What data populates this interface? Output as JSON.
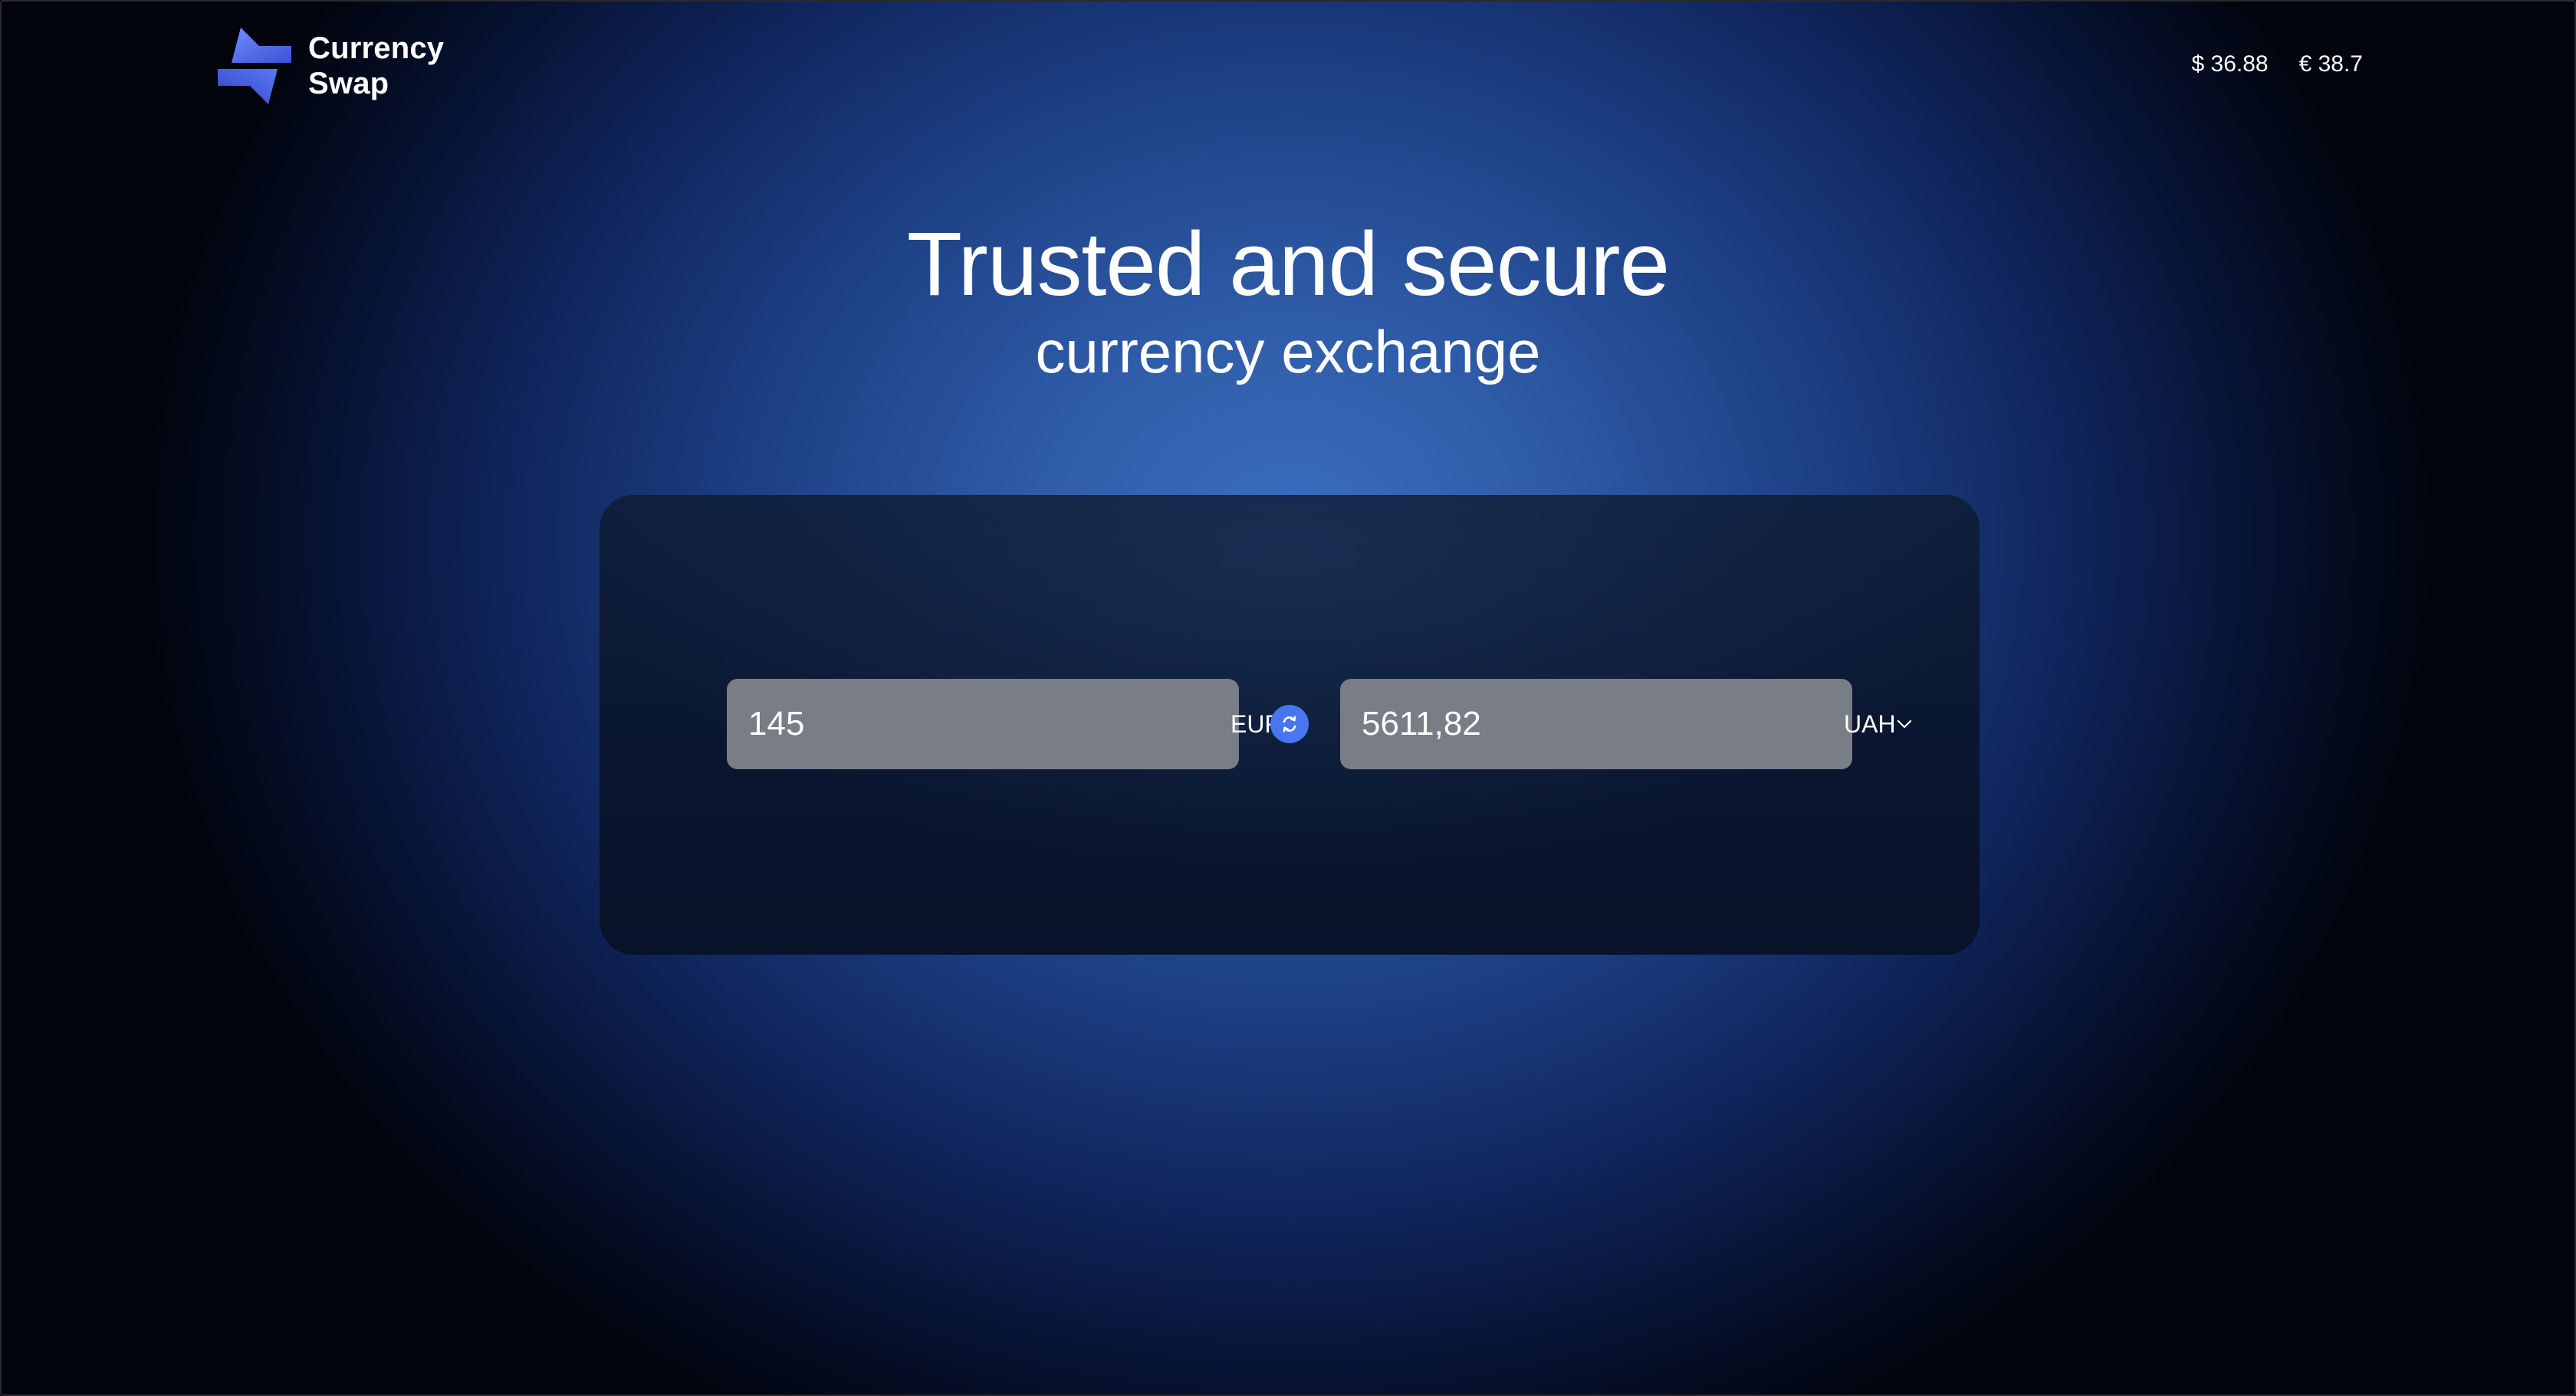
{
  "header": {
    "logo_line1": "Currency",
    "logo_line2": "Swap",
    "rates": [
      {
        "label": "$ 36.88"
      },
      {
        "label": "€ 38.7"
      }
    ]
  },
  "hero": {
    "title": "Trusted and secure",
    "subtitle": "currency exchange"
  },
  "converter": {
    "from": {
      "amount": "145",
      "currency": "EUR"
    },
    "to": {
      "amount": "5611,82",
      "currency": "UAH"
    },
    "swap_icon": "swap-arrows-icon"
  },
  "colors": {
    "accent": "#4876f0",
    "field_bg": "#787d86",
    "card_bg": "#0a1630"
  }
}
